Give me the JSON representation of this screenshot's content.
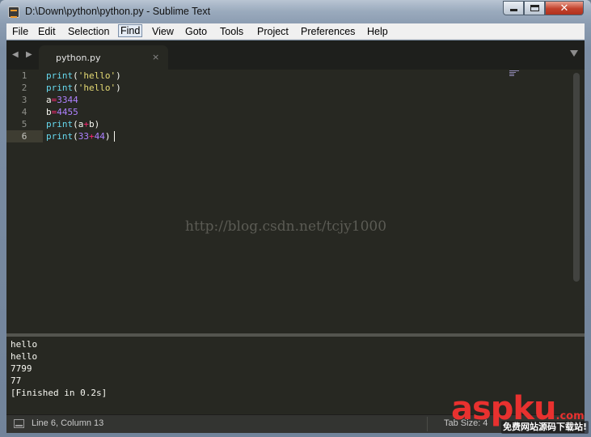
{
  "window": {
    "title": "D:\\Down\\python\\python.py - Sublime Text"
  },
  "menu": [
    "File",
    "Edit",
    "Selection",
    "Find",
    "View",
    "Goto",
    "Tools",
    "Project",
    "Preferences",
    "Help"
  ],
  "tabs": [
    {
      "label": "python.py",
      "close": "×"
    }
  ],
  "nav": {
    "back": "◀",
    "forward": "▶"
  },
  "line_numbers": [
    "1",
    "2",
    "3",
    "4",
    "5",
    "6"
  ],
  "code": [
    [
      {
        "t": "print",
        "c": "f"
      },
      {
        "t": "(",
        "c": "p"
      },
      {
        "t": "'hello'",
        "c": "s"
      },
      {
        "t": ")",
        "c": "p"
      }
    ],
    [
      {
        "t": "print",
        "c": "f"
      },
      {
        "t": "(",
        "c": "p"
      },
      {
        "t": "'hello'",
        "c": "s"
      },
      {
        "t": ")",
        "c": "p"
      }
    ],
    [
      {
        "t": "a",
        "c": "p"
      },
      {
        "t": "=",
        "c": "o"
      },
      {
        "t": "3344",
        "c": "n"
      }
    ],
    [
      {
        "t": "b",
        "c": "p"
      },
      {
        "t": "=",
        "c": "o"
      },
      {
        "t": "4455",
        "c": "n"
      }
    ],
    [
      {
        "t": "print",
        "c": "f"
      },
      {
        "t": "(",
        "c": "p"
      },
      {
        "t": "a",
        "c": "p"
      },
      {
        "t": "+",
        "c": "o"
      },
      {
        "t": "b",
        "c": "p"
      },
      {
        "t": ")",
        "c": "p"
      }
    ],
    [
      {
        "t": "print",
        "c": "f"
      },
      {
        "t": "(",
        "c": "p"
      },
      {
        "t": "33",
        "c": "n"
      },
      {
        "t": "+",
        "c": "o"
      },
      {
        "t": "44",
        "c": "n"
      },
      {
        "t": ")",
        "c": "p"
      }
    ]
  ],
  "current_line": 6,
  "watermark": "http://blog.csdn.net/tcjy1000",
  "console": [
    "hello",
    "hello",
    "7799",
    "77",
    "[Finished in 0.2s]"
  ],
  "status": {
    "position": "Line 6, Column 13",
    "tab_size": "Tab Size: 4"
  },
  "overlay_logo": {
    "name": "aspku",
    "suffix": ".com",
    "tagline": "免费网站源码下载站!"
  },
  "icons": [
    "app-icon",
    "minimize-icon",
    "maximize-icon",
    "close-icon",
    "nav-left-icon",
    "nav-right-icon",
    "tab-close-icon",
    "tab-dropdown-icon",
    "console-toggle-icon"
  ],
  "colors": {
    "editor_bg": "#272822",
    "function": "#66d9ef",
    "string": "#e6db74",
    "operator": "#f92672",
    "number": "#ae81ff",
    "text": "#f8f8f2"
  }
}
